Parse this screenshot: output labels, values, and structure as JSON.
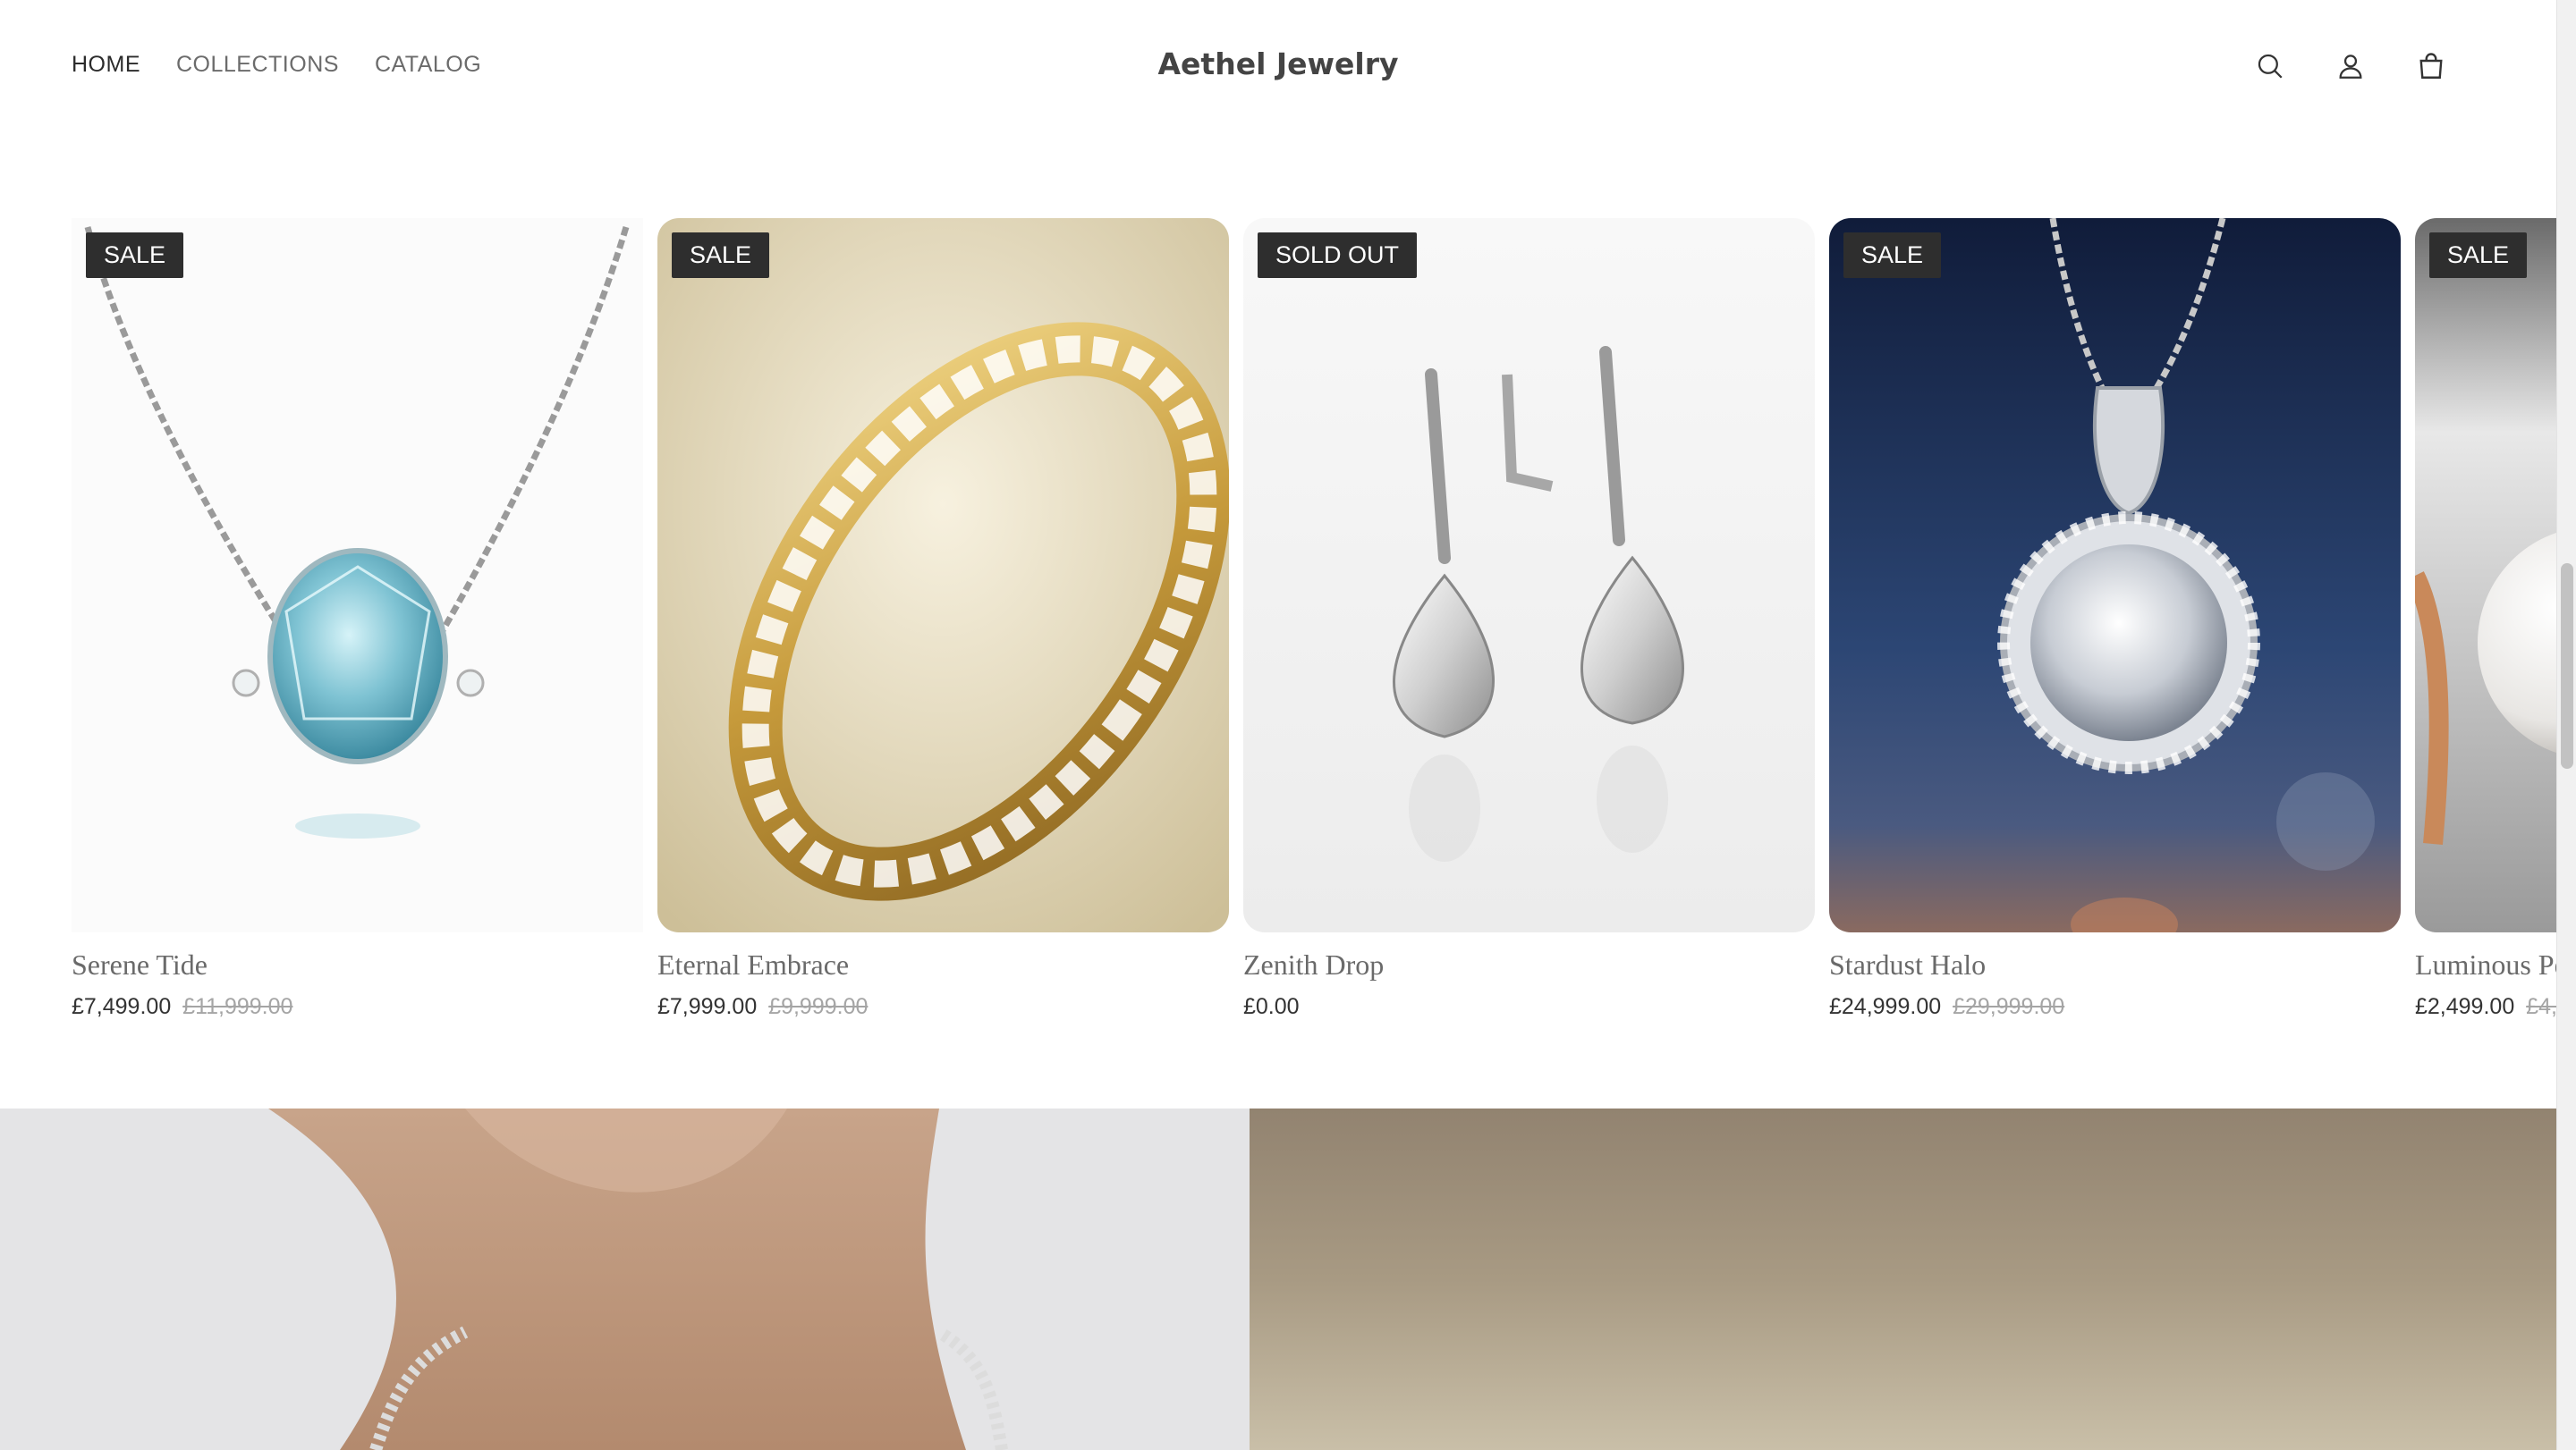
{
  "header": {
    "nav": [
      {
        "label": "HOME"
      },
      {
        "label": "COLLECTIONS"
      },
      {
        "label": "CATALOG"
      }
    ],
    "brand": "Aethel Jewelry",
    "icons": [
      "search-icon",
      "account-icon",
      "cart-icon"
    ]
  },
  "products": [
    {
      "badge": "SALE",
      "name": "Serene Tide",
      "price": "£7,499.00",
      "was": "£11,999.00"
    },
    {
      "badge": "SALE",
      "name": "Eternal Embrace",
      "price": "£7,999.00",
      "was": "£9,999.00"
    },
    {
      "badge": "SOLD OUT",
      "name": "Zenith Drop",
      "price": "£0.00",
      "was": ""
    },
    {
      "badge": "SALE",
      "name": "Stardust Halo",
      "price": "£24,999.00",
      "was": "£29,999.00"
    },
    {
      "badge": "SALE",
      "name": "Luminous Pe",
      "price": "£2,499.00",
      "was": "£4,"
    }
  ]
}
